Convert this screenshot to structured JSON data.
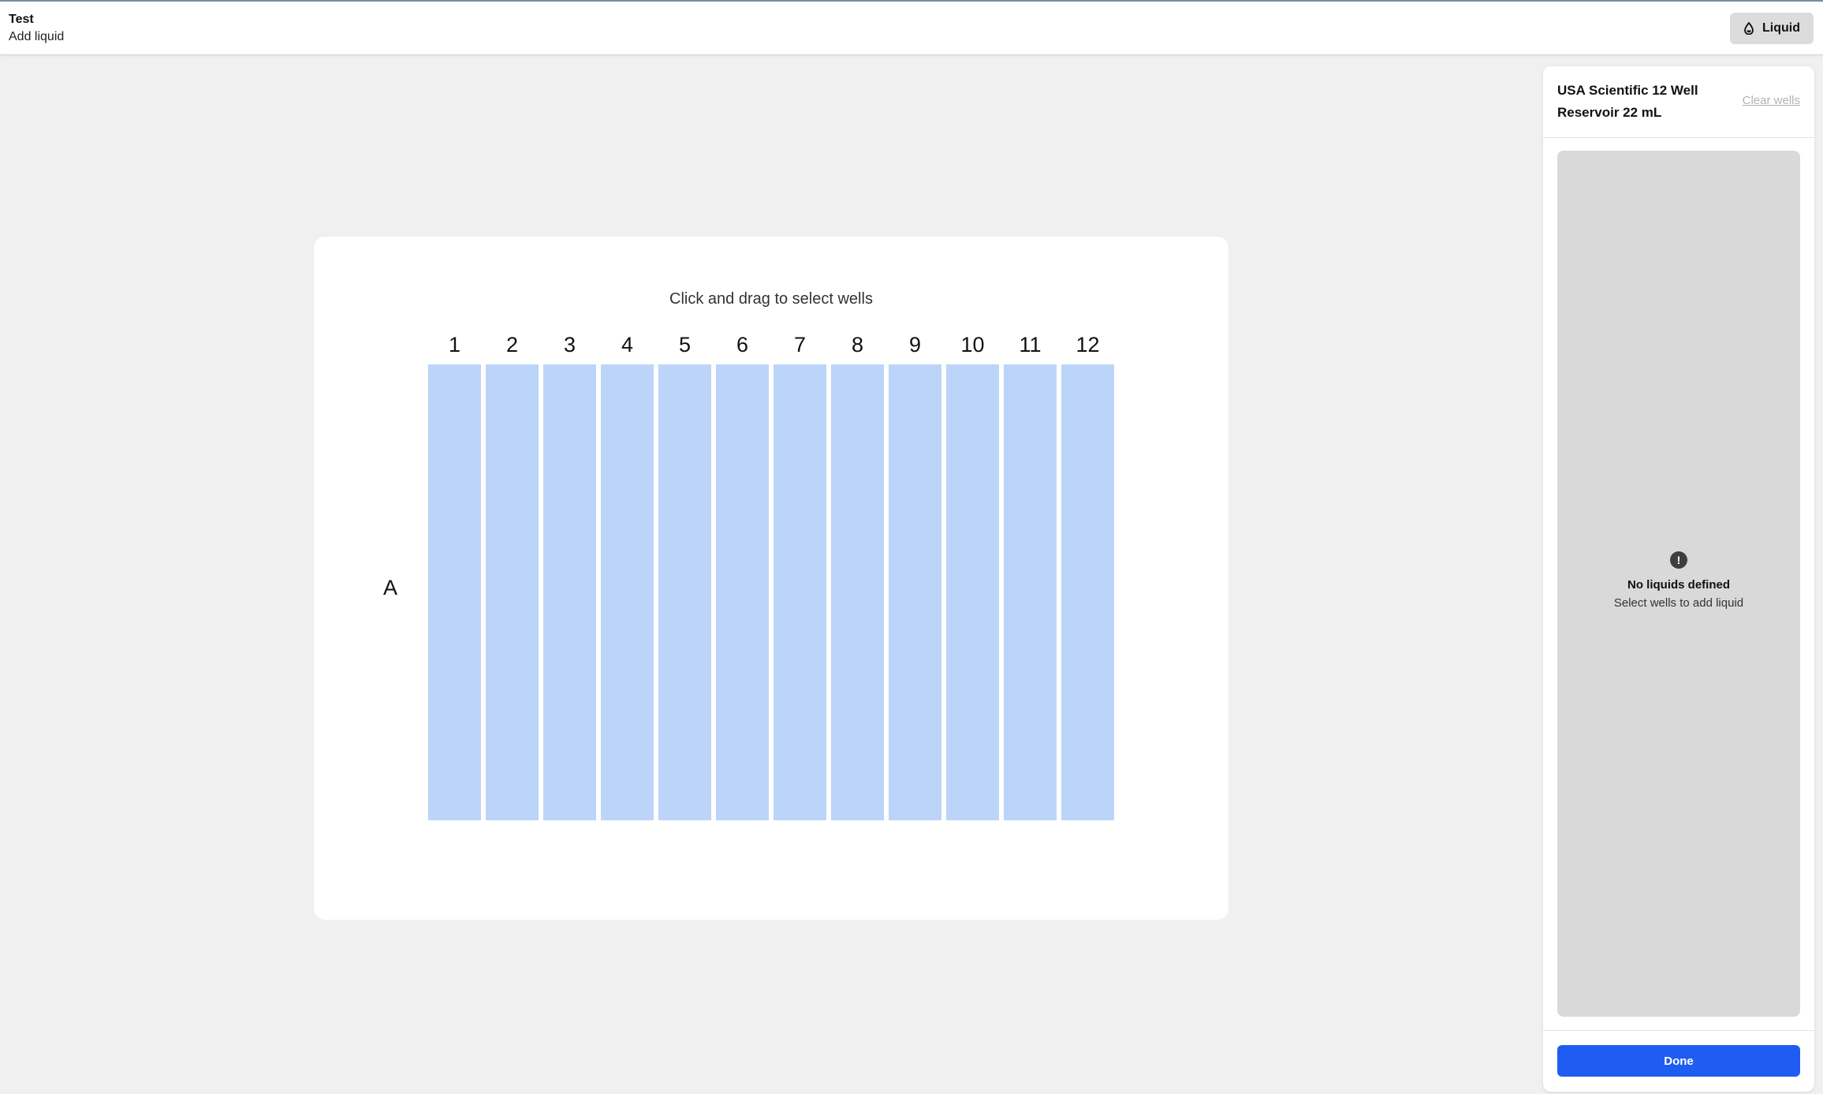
{
  "header": {
    "title": "Test",
    "subtitle": "Add liquid",
    "liquid_button_label": "Liquid",
    "liquid_button_icon": "drop-icon"
  },
  "labware": {
    "instructions": "Click and drag to select wells",
    "columns": [
      "1",
      "2",
      "3",
      "4",
      "5",
      "6",
      "7",
      "8",
      "9",
      "10",
      "11",
      "12"
    ],
    "rows": [
      "A"
    ],
    "well_color": "#bcd4f8"
  },
  "panel": {
    "title": "USA Scientific 12 Well Reservoir 22 mL",
    "clear_wells_label": "Clear wells",
    "empty_icon": "alert-circle-icon",
    "empty_title": "No liquids defined",
    "empty_subtitle": "Select wells to add liquid",
    "done_label": "Done"
  },
  "colors": {
    "accent": "#1f5cf2",
    "background": "#f0f0f0",
    "panel_area": "#d9d9d9"
  }
}
